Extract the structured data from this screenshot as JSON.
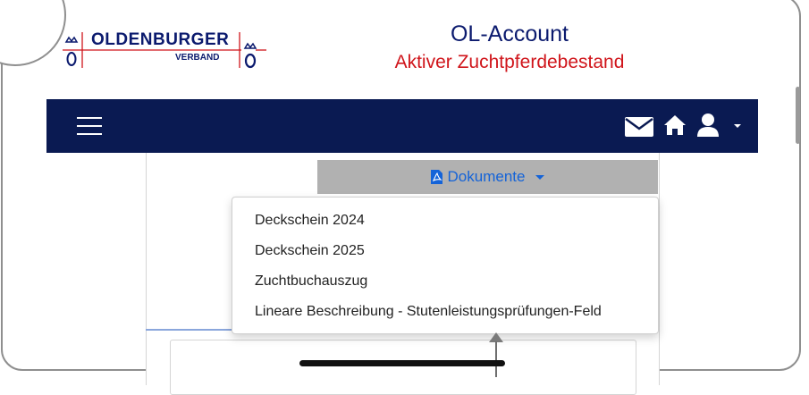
{
  "header": {
    "logo_name": "OLDENBURGER",
    "logo_sub": "VERBAND",
    "title": "OL-Account",
    "subtitle": "Aktiver Zuchtpferdebestand"
  },
  "navbar": {
    "menu_icon": "hamburger-menu-icon",
    "icons": [
      "envelope-icon",
      "home-icon",
      "user-icon",
      "caret-down-icon"
    ]
  },
  "dropdown": {
    "button_label": "Dokumente",
    "button_icon": "pdf-file-icon",
    "items": [
      "Deckschein 2024",
      "Deckschein 2025",
      "Zuchtbuchauszug",
      "Lineare Beschreibung - Stutenleistungsprüfungen-Feld"
    ]
  },
  "colors": {
    "brand_navy": "#0a1a52",
    "title_red": "#d0151b",
    "link_blue": "#1463d8",
    "button_gray": "#b1b1b1"
  }
}
